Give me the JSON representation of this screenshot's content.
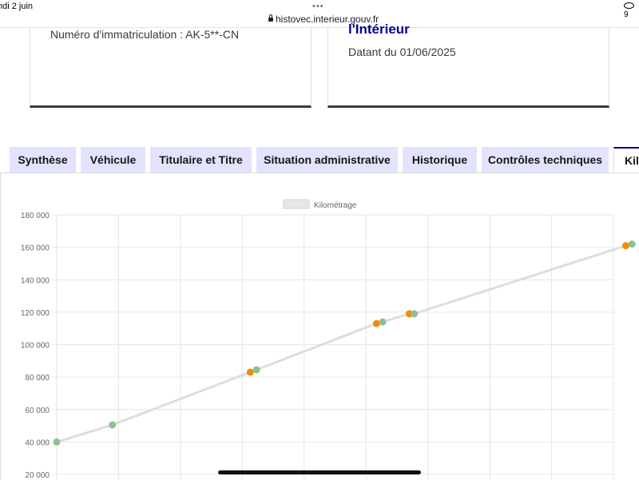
{
  "status_bar": {
    "date": "ndi 2 juin",
    "dots": "•••",
    "url": "histovec.interieur.gouv.fr",
    "right": "9"
  },
  "vehicle_card": {
    "plate_label": "Numéro d'immatriculation : AK-5**-CN"
  },
  "source_card": {
    "title_cut": "l'Intérieur",
    "date_label": "Datant du 01/06/2025"
  },
  "tabs": [
    {
      "label": "Synthèse",
      "active": false
    },
    {
      "label": "Véhicule",
      "active": false
    },
    {
      "label": "Titulaire et Titre",
      "active": false
    },
    {
      "label": "Situation administrative",
      "active": false
    },
    {
      "label": "Historique",
      "active": false
    },
    {
      "label": "Contrôles techniques",
      "active": false
    },
    {
      "label": "Kil",
      "active": true
    }
  ],
  "colors": {
    "accent": "#000091",
    "tab_bg": "#e3e3fd",
    "line": "#dddddd",
    "point_green": "#8fc18f",
    "point_orange": "#f28c10"
  },
  "chart_data": {
    "type": "line",
    "legend": [
      "Kilométrage"
    ],
    "legend_position": "top-center",
    "grid": true,
    "ylim": [
      20000,
      180000
    ],
    "y_ticks": [
      "180 000",
      "160 000",
      "140 000",
      "120 000",
      "100 000",
      "80 000",
      "60 000",
      "40 000",
      "20 000"
    ],
    "x_count": 10,
    "series": [
      {
        "name": "Kilométrage",
        "points": [
          {
            "x": 0,
            "y": 40000,
            "color": "green"
          },
          {
            "x": 0.9,
            "y": 50500,
            "color": "green"
          },
          {
            "x": 3.13,
            "y": 83000,
            "color": "orange"
          },
          {
            "x": 3.23,
            "y": 84500,
            "color": "green"
          },
          {
            "x": 5.17,
            "y": 113000,
            "color": "orange"
          },
          {
            "x": 5.27,
            "y": 114000,
            "color": "green"
          },
          {
            "x": 5.7,
            "y": 119000,
            "color": "orange"
          },
          {
            "x": 5.78,
            "y": 119000,
            "color": "green"
          },
          {
            "x": 9.2,
            "y": 161000,
            "color": "orange"
          },
          {
            "x": 9.3,
            "y": 162000,
            "color": "green"
          }
        ]
      }
    ]
  }
}
